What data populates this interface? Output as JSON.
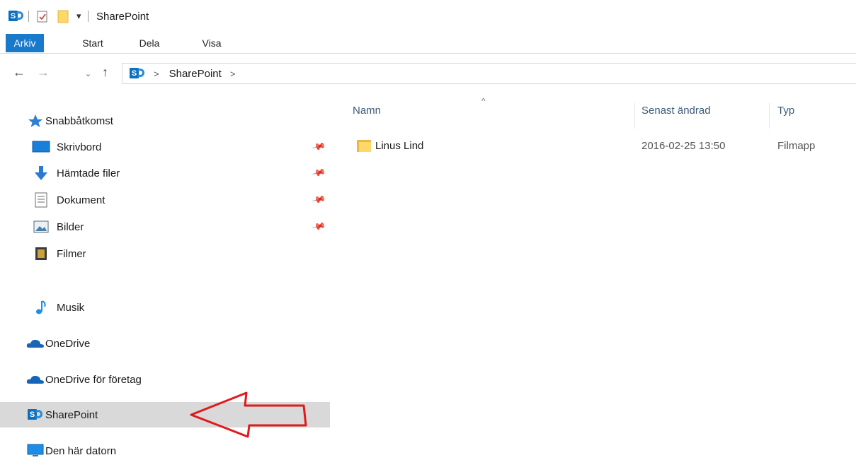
{
  "window": {
    "title": "SharePoint"
  },
  "ribbon": {
    "tabs": [
      {
        "label": "Arkiv",
        "active": true
      },
      {
        "label": "Start",
        "active": false
      },
      {
        "label": "Dela",
        "active": false
      },
      {
        "label": "Visa",
        "active": false
      }
    ]
  },
  "address": {
    "separator": ">",
    "crumbs": [
      "SharePoint"
    ],
    "trailing": ">"
  },
  "nav": {
    "quick_access": "Snabbåtkomst",
    "items": [
      {
        "label": "Skrivbord",
        "icon": "desktop-icon",
        "pinned": true
      },
      {
        "label": "Hämtade filer",
        "icon": "download-icon",
        "pinned": true
      },
      {
        "label": "Dokument",
        "icon": "document-icon",
        "pinned": true
      },
      {
        "label": "Bilder",
        "icon": "pictures-icon",
        "pinned": true
      },
      {
        "label": "Filmer",
        "icon": "video-icon",
        "pinned": false
      },
      {
        "label": "Musik",
        "icon": "music-icon",
        "pinned": false
      }
    ],
    "onedrive": "OneDrive",
    "onedrive_business": "OneDrive för företag",
    "sharepoint": "SharePoint",
    "this_pc": "Den här datorn"
  },
  "list": {
    "columns": {
      "name": "Namn",
      "modified": "Senast ändrad",
      "type": "Typ"
    },
    "rows": [
      {
        "name": "Linus Lind",
        "modified": "2016-02-25 13:50",
        "type": "Filmapp"
      }
    ]
  },
  "colors": {
    "accent": "#1979ca",
    "selection": "#d9d9d9",
    "annotation": "#e0191c"
  }
}
